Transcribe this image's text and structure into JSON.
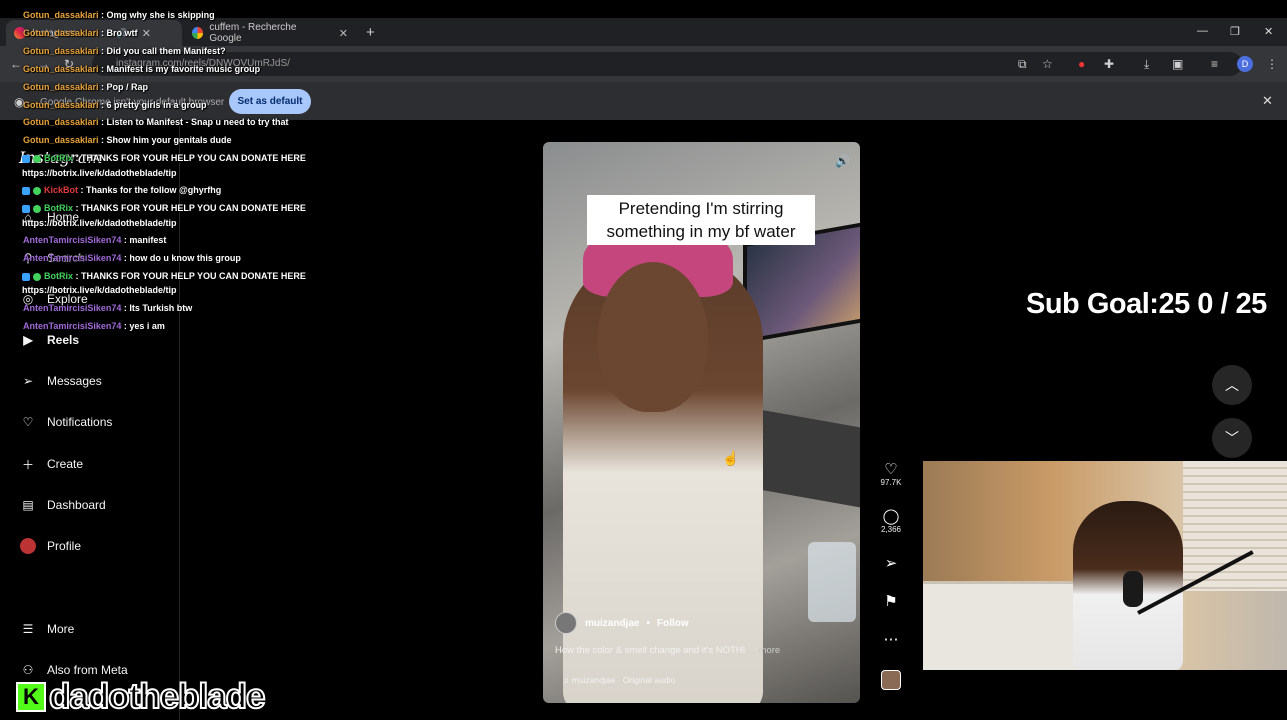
{
  "browser": {
    "tabs": [
      {
        "label": "Instagram"
      },
      {
        "label": "cuffem - Recherche Google"
      }
    ],
    "new_tab": "+",
    "url": "instagram.com/reels/DNWOVUmRJdS/",
    "window_controls": [
      "—",
      "❐",
      "✕"
    ],
    "infobar": {
      "text": "Google Chrome isn't your default browser",
      "button": "Set as default",
      "close": "✕"
    }
  },
  "sidebar": {
    "logo": "Instagram",
    "items": [
      {
        "label": "Home",
        "icon": "home-icon"
      },
      {
        "label": "Search",
        "icon": "search-icon"
      },
      {
        "label": "Explore",
        "icon": "compass-icon"
      },
      {
        "label": "Reels",
        "icon": "reels-icon"
      },
      {
        "label": "Messages",
        "icon": "messages-icon"
      },
      {
        "label": "Notifications",
        "icon": "heart-icon"
      },
      {
        "label": "Create",
        "icon": "plus-icon"
      },
      {
        "label": "Dashboard",
        "icon": "dashboard-icon"
      },
      {
        "label": "Profile",
        "icon": "avatar-icon"
      },
      {
        "label": "More",
        "icon": "menu-icon"
      },
      {
        "label": "Also from Meta",
        "icon": "meta-icon"
      }
    ]
  },
  "chat": [
    {
      "user": "Gotun_dassaklari",
      "text": ": Omg why she is skipping"
    },
    {
      "user": "Gotun_dassaklari",
      "text": ": Bro wtf"
    },
    {
      "user": "Gotun_dassaklari",
      "text": ": Did you call them Manifest?"
    },
    {
      "user": "Gotun_dassaklari",
      "text": ": Manifest is my favorite music group"
    },
    {
      "user": "Gotun_dassaklari",
      "text": ": Pop / Rap"
    },
    {
      "user": "Gotun_dassaklari",
      "text": ": 6 pretty girls in a group"
    },
    {
      "user": "Gotun_dassaklari",
      "text": ": Listen to Manifest - Snap u need to try that"
    },
    {
      "user": "Gotun_dassaklari",
      "text": ": Show him your genitals dude"
    },
    {
      "user": "BotRix",
      "text": ": THANKS FOR YOUR HELP YOU CAN DONATE HERE"
    },
    {
      "user": "",
      "text": "https://botrix.live/k/dadotheblade/tip"
    },
    {
      "user": "KickBot",
      "text": ": Thanks for the follow @ghyrfhg"
    },
    {
      "user": "BotRix",
      "text": ": THANKS FOR YOUR HELP YOU CAN DONATE HERE"
    },
    {
      "user": "",
      "text": "https://botrix.live/k/dadotheblade/tip"
    },
    {
      "user": "AntenTamircisiSiken74",
      "text": ": manifest"
    },
    {
      "user": "AntenTamircisiSiken74",
      "text": ": how do u know this group"
    },
    {
      "user": "BotRix",
      "text": ": THANKS FOR YOUR HELP YOU CAN DONATE HERE"
    },
    {
      "user": "",
      "text": "https://botrix.live/k/dadotheblade/tip"
    },
    {
      "user": "AntenTamircisiSiken74",
      "text": ": Its Turkish btw"
    },
    {
      "user": "AntenTamircisiSiken74",
      "text": ": yes i am"
    }
  ],
  "reel": {
    "caption": "Pretending I'm stirring something in my bf water",
    "author": "muizandjae",
    "separator": "•",
    "follow": "Follow",
    "description": "How the color & smell change and it's NOTHI",
    "more": "... more",
    "audio": "muizandjae · Original audio",
    "volume_icon": "🔊"
  },
  "actions": {
    "likes": "97.7K",
    "comments": "2,366"
  },
  "overlay": {
    "sub_goal": "Sub Goal:25  0 / 25",
    "brand": "dadotheblade",
    "brand_logo": "K"
  },
  "colors": {
    "username": "#e8a33b",
    "kick_green": "#53fc18",
    "set_default_bg": "#a8c7fa"
  }
}
